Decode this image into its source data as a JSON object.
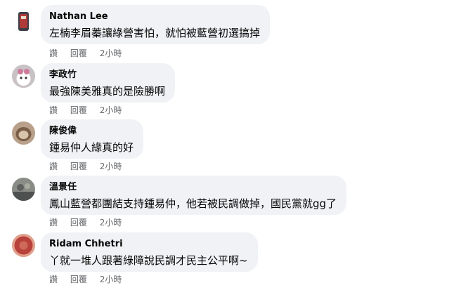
{
  "comments": [
    {
      "author": "Nathan Lee",
      "text": "左楠李眉蓁讓綠營害怕，就怕被藍營初選搞掉",
      "like_label": "讚",
      "reply_label": "回覆",
      "time": "2小時",
      "avatar_icon": "profile-photo-icon",
      "avatar_colors": [
        "#3d3d46",
        "#b03a3a"
      ]
    },
    {
      "author": "李政竹",
      "text": "最強陳美雅真的是險勝啊",
      "like_label": "讚",
      "reply_label": "回覆",
      "time": "2小時",
      "avatar_icon": "profile-photo-icon",
      "avatar_colors": [
        "#c9c2c4",
        "#d07a9b"
      ]
    },
    {
      "author": "陳俊偉",
      "text": "鍾易仲人緣真的好",
      "like_label": "讚",
      "reply_label": "回覆",
      "time": "2小時",
      "avatar_icon": "profile-photo-icon",
      "avatar_colors": [
        "#b9a08a",
        "#7a5e45"
      ]
    },
    {
      "author": "溫景任",
      "text": "鳳山藍營都團結支持鍾易仲，他若被民調做掉，國民黨就gg了",
      "like_label": "讚",
      "reply_label": "回覆",
      "time": "2小時",
      "avatar_icon": "profile-photo-icon",
      "avatar_colors": [
        "#8a8d86",
        "#4d5150"
      ]
    },
    {
      "author": "Ridam Chhetri",
      "text": "丫就一堆人跟著綠障說民調才民主公平啊~",
      "like_label": "讚",
      "reply_label": "回覆",
      "time": "2小時",
      "avatar_icon": "profile-photo-icon",
      "avatar_colors": [
        "#b8423b",
        "#e0a08c"
      ]
    }
  ],
  "colors": {
    "bubble_bg": "#f0f2f5",
    "meta_text": "#65676b",
    "body_text": "#050505"
  }
}
